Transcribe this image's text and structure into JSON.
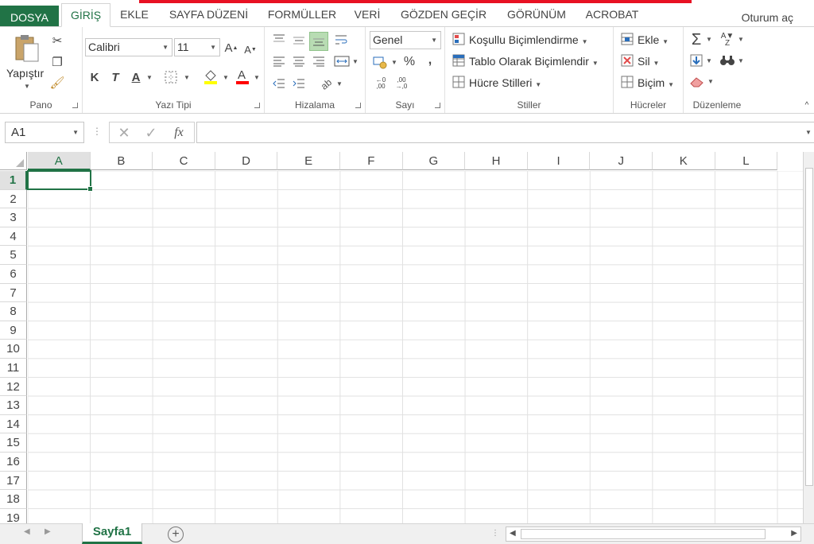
{
  "tabs": [
    {
      "label": "DOSYA"
    },
    {
      "label": "GİRİŞ"
    },
    {
      "label": "EKLE"
    },
    {
      "label": "SAYFA DÜZENİ"
    },
    {
      "label": "FORMÜLLER"
    },
    {
      "label": "VERİ"
    },
    {
      "label": "GÖZDEN GEÇİR"
    },
    {
      "label": "GÖRÜNÜM"
    },
    {
      "label": "ACROBAT"
    }
  ],
  "user": "Oturum aç",
  "ribbon": {
    "pano": {
      "label": "Pano",
      "paste": "Yapıştır"
    },
    "font": {
      "label": "Yazı Tipi",
      "name": "Calibri",
      "size": "11",
      "bold": "K",
      "italic": "T",
      "underline": "A"
    },
    "align": {
      "label": "Hizalama"
    },
    "number": {
      "label": "Sayı",
      "format": "Genel"
    },
    "styles": {
      "label": "Stiller",
      "cond": "Koşullu Biçimlendirme",
      "table": "Tablo Olarak Biçimlendir",
      "cell": "Hücre Stilleri"
    },
    "cells": {
      "label": "Hücreler",
      "insert": "Ekle",
      "delete": "Sil",
      "format": "Biçim"
    },
    "edit": {
      "label": "Düzenleme"
    }
  },
  "namebox": "A1",
  "columns": [
    "A",
    "B",
    "C",
    "D",
    "E",
    "F",
    "G",
    "H",
    "I",
    "J",
    "K",
    "L"
  ],
  "rows": [
    "1",
    "2",
    "3",
    "4",
    "5",
    "6",
    "7",
    "8",
    "9",
    "10",
    "11",
    "12",
    "13",
    "14",
    "15",
    "16",
    "17",
    "18",
    "19"
  ],
  "sheet": "Sayfa1",
  "colors": {
    "accent": "#217346",
    "redbar": "#e81123"
  }
}
